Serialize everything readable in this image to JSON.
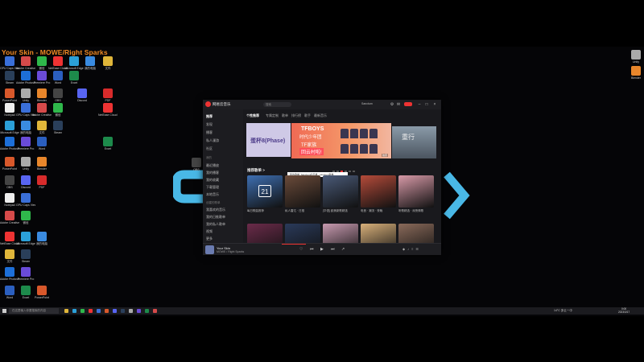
{
  "overlay_title": "Your Skin - MOWE/Right Sparks",
  "desktop_icons": [
    {
      "label": "GPU Caps Viewer",
      "color": "#3a6fd8"
    },
    {
      "label": "Adobe Creative Cloud",
      "color": "#d64a4a"
    },
    {
      "label": "微信",
      "color": "#2fb84b"
    },
    {
      "label": "NetEase Cloud Music",
      "color": "#e33"
    },
    {
      "label": "Microsoft Edge",
      "color": "#2ba0d8"
    },
    {
      "label": "我的电脑",
      "color": "#3a8be0"
    },
    {
      "label": "文件",
      "color": "#e0b63a"
    },
    {
      "label": "Steam",
      "color": "#2a3f5a"
    },
    {
      "label": "Adobe Photoshop",
      "color": "#1d6fd8"
    },
    {
      "label": "Premiere Pro",
      "color": "#6a4bd8"
    },
    {
      "label": "Word",
      "color": "#2b5fbf"
    },
    {
      "label": "Excel",
      "color": "#1d8a4b"
    },
    {
      "label": "PowerPoint",
      "color": "#d8582b"
    },
    {
      "label": "Unity",
      "color": "#aaa"
    },
    {
      "label": "Blender",
      "color": "#e8862b"
    },
    {
      "label": "OBS",
      "color": "#444"
    },
    {
      "label": "Discord",
      "color": "#5865f2"
    },
    {
      "label": "PDF",
      "color": "#d82b2b"
    },
    {
      "label": "Notepad",
      "color": "#eee"
    }
  ],
  "app": {
    "name": "网易云音乐",
    "search_placeholder": "搜索",
    "user": "Sanctum",
    "sidebar": {
      "items": [
        "推荐",
        "发现",
        "播客",
        "私人漫游",
        "社区",
        "我的",
        "最近播放",
        "我的播客",
        "我的收藏",
        "下载管理",
        "本地音乐",
        "创建的歌单",
        "我喜欢的音乐",
        "我的日推歌单",
        "我的私人歌单",
        "视频",
        "更多"
      ],
      "active": "推荐"
    },
    "tabs": [
      "个性推荐",
      "专属定制",
      "歌单",
      "排行榜",
      "歌手",
      "最新音乐"
    ],
    "active_tab": "个性推荐",
    "banners": {
      "left_text": "蛋杯8(Phase)",
      "center_line1": "TFBOYS",
      "center_line2": "时代少年团",
      "center_line3": "TF家族",
      "center_line4": "回云村啦!",
      "center_tag": "独家",
      "right_text": "重行"
    },
    "section_title": "推荐歌单 >",
    "tooltip": "我的歌单: Sanctum的日推 · sanctum歌单",
    "playlists_row1": [
      {
        "caption": "每日歌曲推荐",
        "color": "#3e6fb2"
      },
      {
        "caption": "私人雷达 · 日推",
        "color": "#6b4b3a"
      },
      {
        "caption": "[华语] 欧美新歌精选",
        "color": "#4a5a78"
      },
      {
        "caption": "电音 · 潮流 · 夜晚",
        "color": "#b54b3a"
      },
      {
        "caption": "听歌精选 · 深夜情歌",
        "color": "#d89aa8"
      }
    ],
    "playlists_row2": [
      {
        "color": "#6b2b4a"
      },
      {
        "color": "#2a3a5a"
      },
      {
        "color": "#c89ab0"
      },
      {
        "color": "#d8b07a"
      },
      {
        "color": "#8a6a5a"
      }
    ],
    "player": {
      "title": "Your Skin",
      "artist": "MOWE / Right Sparks"
    }
  },
  "taskbar": {
    "search_placeholder": "在这里输入你要搜索的内容",
    "tray_text": "14°C 多云 ^ 中",
    "time": "0:00",
    "date": "2023/3/17"
  }
}
